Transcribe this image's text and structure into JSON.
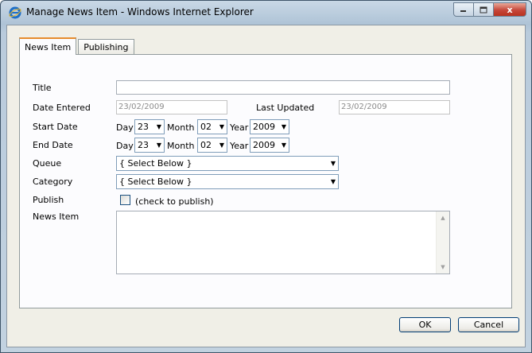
{
  "window": {
    "title": "Manage News Item - Windows Internet Explorer",
    "icon": "ie-icon",
    "minimize_icon": "minimize-icon",
    "maximize_icon": "maximize-icon",
    "close_label": "x"
  },
  "tabs": [
    {
      "label": "News Item",
      "active": true
    },
    {
      "label": "Publishing",
      "active": false
    }
  ],
  "form": {
    "title_label": "Title",
    "title_value": "",
    "date_entered_label": "Date Entered",
    "date_entered_value": "23/02/2009",
    "last_updated_label": "Last Updated",
    "last_updated_value": "23/02/2009",
    "start_date_label": "Start Date",
    "end_date_label": "End Date",
    "day_label": "Day",
    "month_label": "Month",
    "year_label": "Year",
    "start_day": "23",
    "start_month": "02",
    "start_year": "2009",
    "end_day": "23",
    "end_month": "02",
    "end_year": "2009",
    "queue_label": "Queue",
    "queue_value": "{ Select Below }",
    "category_label": "Category",
    "category_value": "{ Select Below }",
    "publish_label": "Publish",
    "publish_hint": "(check to publish)",
    "news_item_label": "News Item",
    "news_item_value": ""
  },
  "buttons": {
    "ok": "OK",
    "cancel": "Cancel"
  },
  "colors": {
    "tab_accent": "#e68b2c",
    "client_bg": "#f0efe7",
    "panel_bg": "#fcfcfe"
  }
}
